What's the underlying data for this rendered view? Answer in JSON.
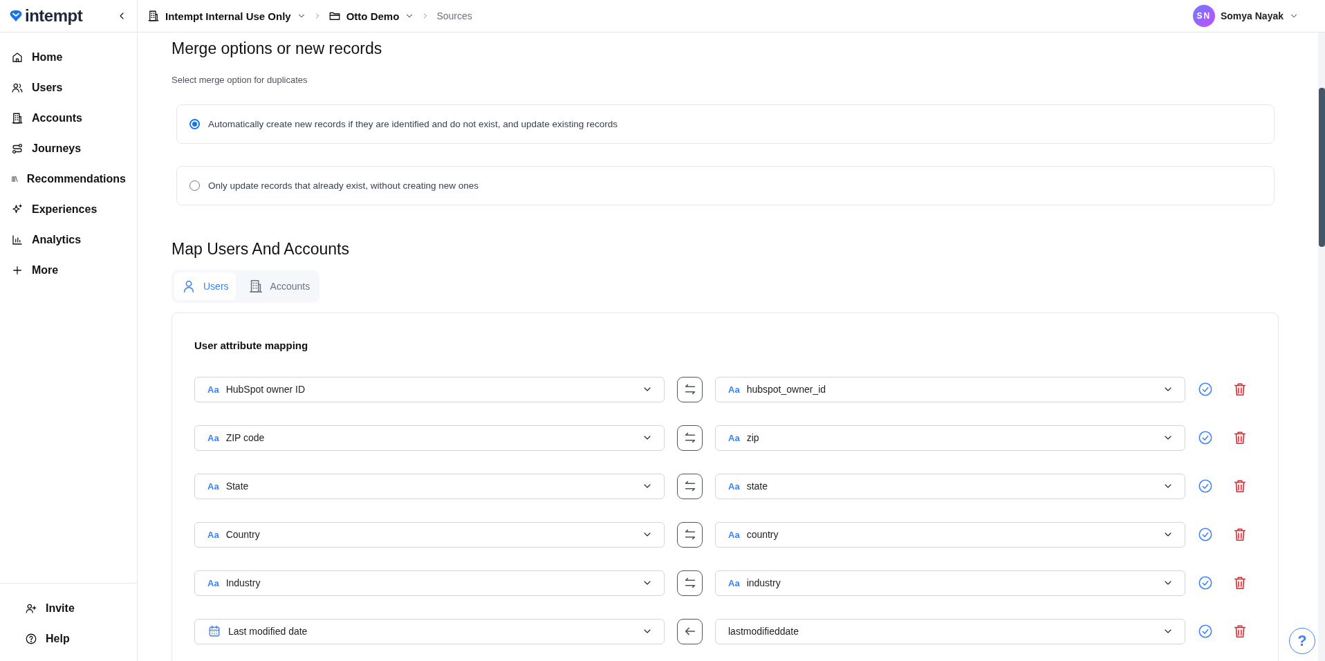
{
  "sidebar": {
    "logo": "intempt",
    "items": [
      {
        "label": "Home",
        "selected": false
      },
      {
        "label": "Users",
        "selected": false
      },
      {
        "label": "Accounts",
        "selected": false
      },
      {
        "label": "Journeys",
        "selected": false
      },
      {
        "label": "Recommendations",
        "selected": false
      },
      {
        "label": "Experiences",
        "selected": false
      },
      {
        "label": "Analytics",
        "selected": false
      },
      {
        "label": "More",
        "selected": false
      }
    ],
    "bottom_items": [
      {
        "label": "Invite"
      },
      {
        "label": "Help"
      }
    ]
  },
  "breadcrumb": [
    {
      "label": "Intempt Internal Use Only"
    },
    {
      "label": "Otto Demo"
    },
    {
      "label": "Sources"
    }
  ],
  "user": {
    "initials": "SN",
    "name": "Somya Nayak"
  },
  "merge": {
    "title": "Merge options or new records",
    "subtitle": "Select merge option for duplicates",
    "options": [
      {
        "label": "Automatically create new records if they are identified and do not exist, and update existing records",
        "selected": true
      },
      {
        "label": "Only update records that already exist, without creating new ones",
        "selected": false
      }
    ]
  },
  "mapping": {
    "title": "Map Users And Accounts",
    "tabs": [
      {
        "label": "Users",
        "selected": true
      },
      {
        "label": "Accounts",
        "selected": false
      }
    ],
    "card_title": "User attribute mapping",
    "rows": [
      {
        "kind": "both",
        "source": {
          "kind": "text",
          "type_icon": "Aa",
          "label": "HubSpot owner ID"
        },
        "target": {
          "kind": "text",
          "type_icon": "Aa",
          "label": "hubspot_owner_id"
        }
      },
      {
        "kind": "both",
        "source": {
          "kind": "text",
          "type_icon": "Aa",
          "label": "ZIP code"
        },
        "target": {
          "kind": "text",
          "type_icon": "Aa",
          "label": "zip"
        }
      },
      {
        "kind": "both",
        "source": {
          "kind": "text",
          "type_icon": "Aa",
          "label": "State"
        },
        "target": {
          "kind": "text",
          "type_icon": "Aa",
          "label": "state"
        }
      },
      {
        "kind": "both",
        "source": {
          "kind": "text",
          "type_icon": "Aa",
          "label": "Country"
        },
        "target": {
          "kind": "text",
          "type_icon": "Aa",
          "label": "country"
        }
      },
      {
        "kind": "both",
        "source": {
          "kind": "text",
          "type_icon": "Aa",
          "label": "Industry"
        },
        "target": {
          "kind": "text",
          "type_icon": "Aa",
          "label": "industry"
        }
      },
      {
        "kind": "left",
        "source": {
          "kind": "date",
          "label": "Last modified date"
        },
        "target": {
          "kind": "none",
          "label": "lastmodifieddate"
        }
      }
    ]
  },
  "help_button": "?"
}
